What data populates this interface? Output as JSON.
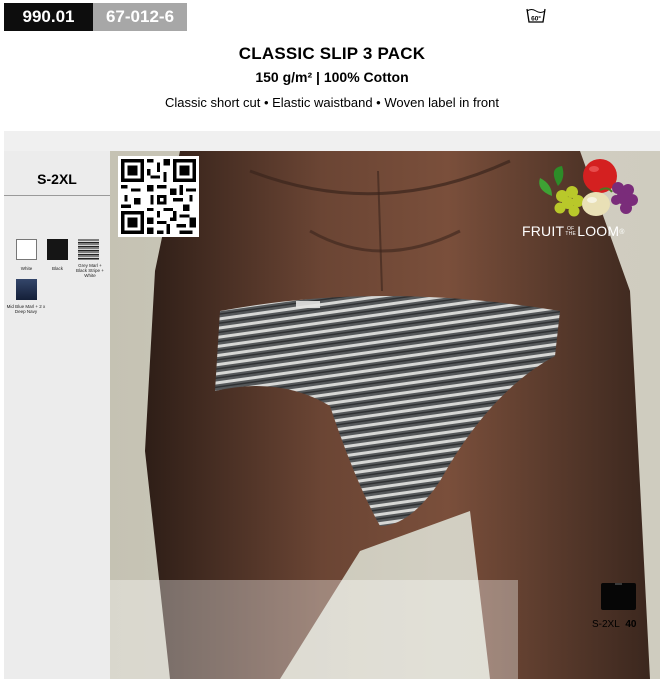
{
  "header": {
    "article_number": "990.01",
    "reference_code": "67-012-6",
    "wash_symbol": "60°"
  },
  "product": {
    "title": "CLASSIC SLIP 3 PACK",
    "subtitle": "150 g/m² | 100% Cotton",
    "features": "Classic short cut • Elastic waistband • Woven label in front"
  },
  "sizes": {
    "range": "S-2XL"
  },
  "colors": [
    {
      "name": "White",
      "swatch": "#ffffff"
    },
    {
      "name": "Black",
      "swatch": "#151515"
    },
    {
      "name": "Grey Marl + Black Stripe + White",
      "swatch": "#8d8d8d"
    },
    {
      "name": "Mid Blue Marl + 2 x Deep Navy",
      "swatch": "#1b2945"
    }
  ],
  "brand": {
    "name": "FRUIT OF THE LOOM",
    "word_main": "FRUIT",
    "word_small": "OF THE",
    "word_end": "LOOM",
    "mark": "®",
    "icon": "fruit-cluster-logo"
  },
  "packaging": {
    "icon": "package-box-icon",
    "size_label": "S-2XL",
    "quantity": "40"
  },
  "theme": {
    "dark": "#0d0d0d",
    "grey": "#a7a7a7",
    "panel": "#ececec"
  }
}
